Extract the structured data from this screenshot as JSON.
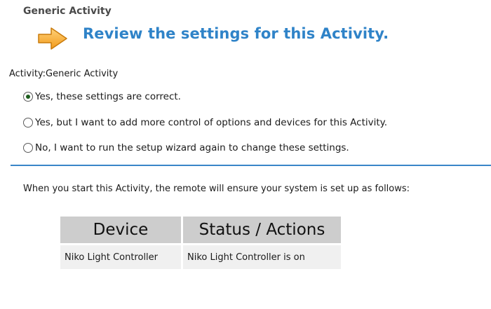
{
  "section_title": "Generic Activity",
  "headline": "Review the settings for this Activity.",
  "icons": {
    "arrow": "orange-arrow-right-icon",
    "arrow_color": "#f5a623"
  },
  "activity": {
    "line": "Activity:Generic Activity"
  },
  "options": [
    {
      "label": "Yes, these settings are correct.",
      "selected": true
    },
    {
      "label": "Yes, but I want to add more control of options and devices for this Activity.",
      "selected": false
    },
    {
      "label": "No, I want to run the setup wizard again to change these settings.",
      "selected": false
    }
  ],
  "intro_text": "When you start this Activity, the remote will ensure your system is set up as follows:",
  "table": {
    "headers": [
      "Device",
      "Status / Actions"
    ],
    "rows": [
      [
        "Niko Light Controller",
        "Niko Light Controller is on"
      ]
    ]
  },
  "colors": {
    "headline": "#2f83c8",
    "divider": "#3a86c8",
    "header_bg": "#cdcdcd",
    "row_bg": "#f0f0f0"
  }
}
